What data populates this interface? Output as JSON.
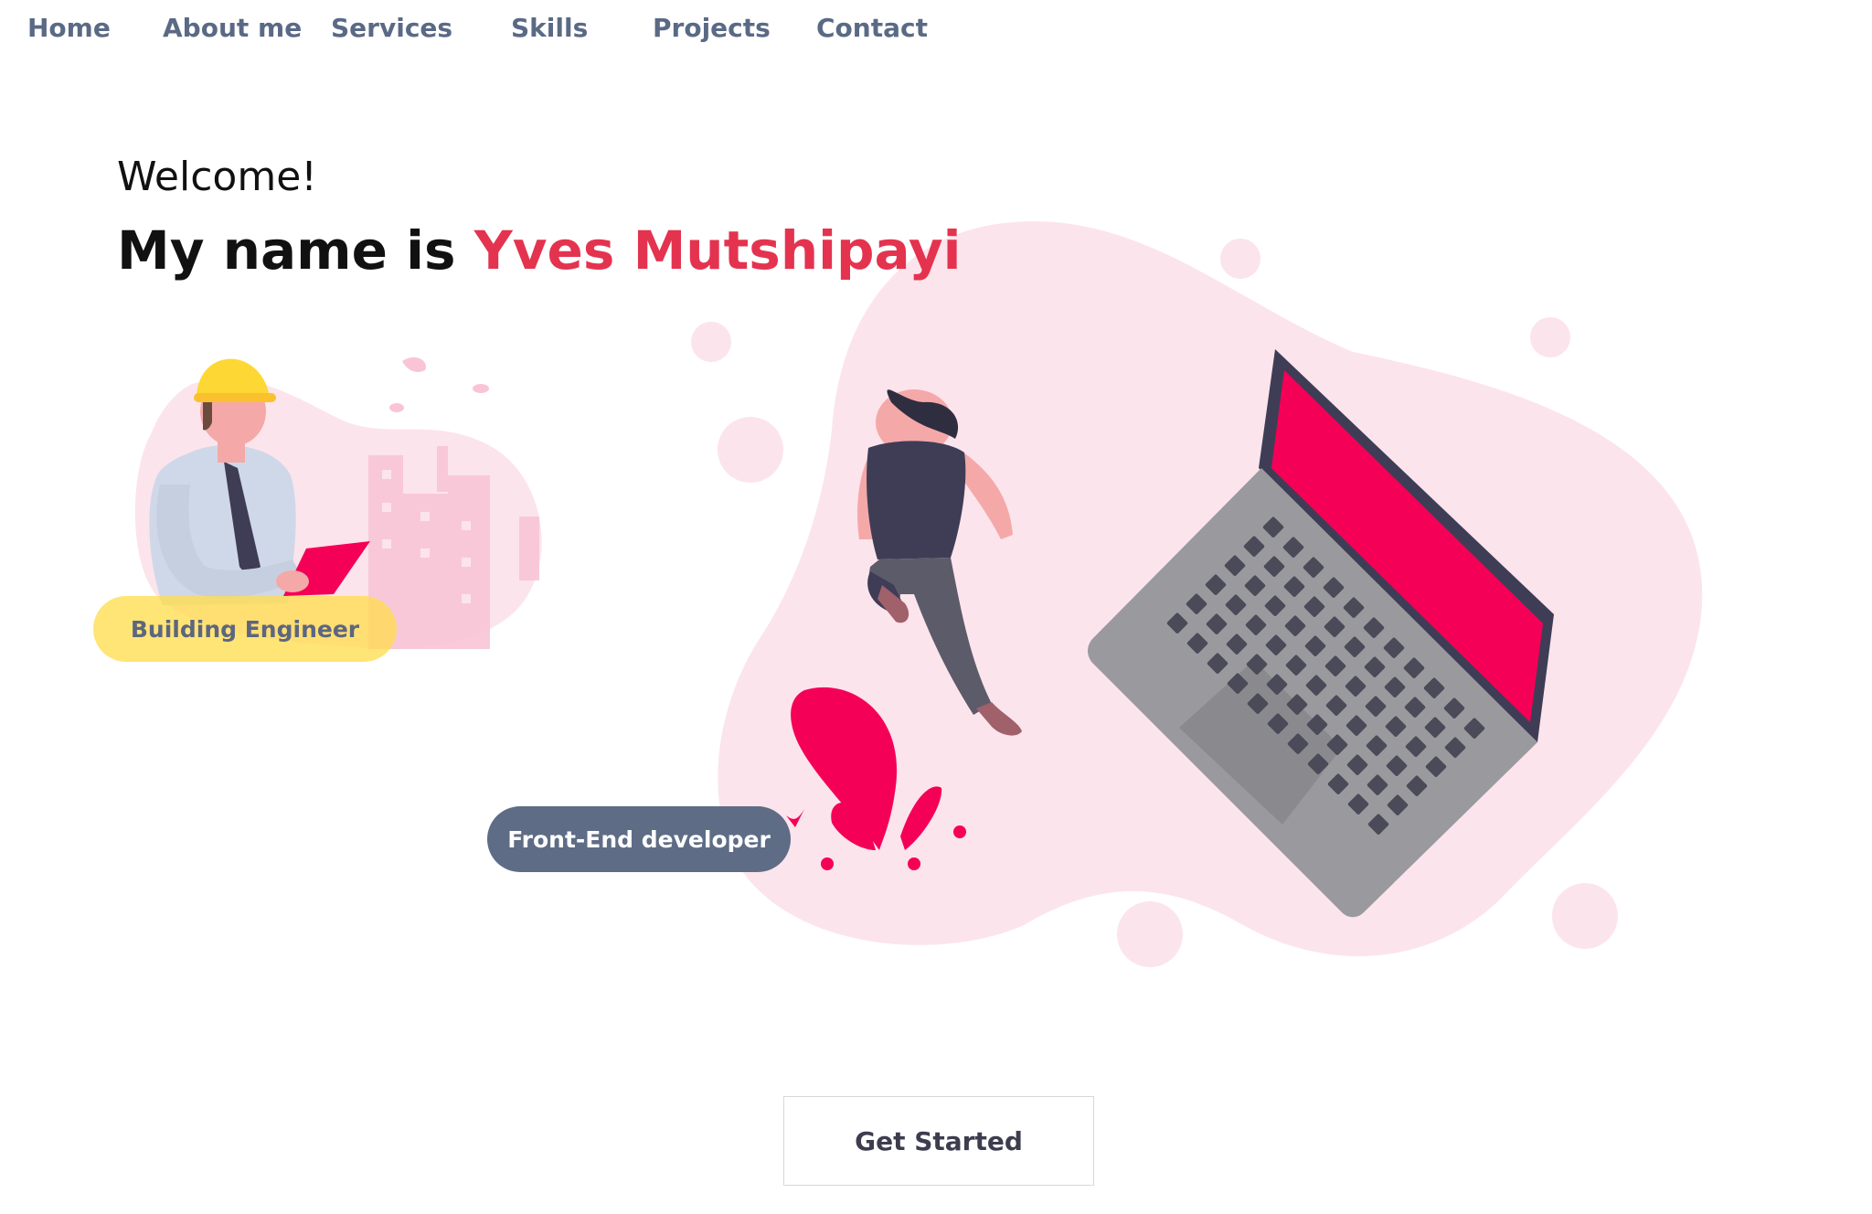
{
  "nav": {
    "items": [
      {
        "label": "Home"
      },
      {
        "label": "About me"
      },
      {
        "label": "Services"
      },
      {
        "label": "Skills"
      },
      {
        "label": "Projects"
      },
      {
        "label": "Contact"
      }
    ]
  },
  "hero": {
    "greeting": "Welcome!",
    "name_prefix": "My name is ",
    "name": "Yves Mutshipayi"
  },
  "badges": {
    "engineer": "Building Engineer",
    "developer": "Front-End developer"
  },
  "cta": {
    "label": "Get Started"
  },
  "colors": {
    "accent": "#e4334f",
    "nav_text": "#5a6a85",
    "blob": "#fce4ec",
    "laptop_screen": "#f50057",
    "badge_yellow": "#ffdd50",
    "badge_dark": "#5e6c86"
  }
}
